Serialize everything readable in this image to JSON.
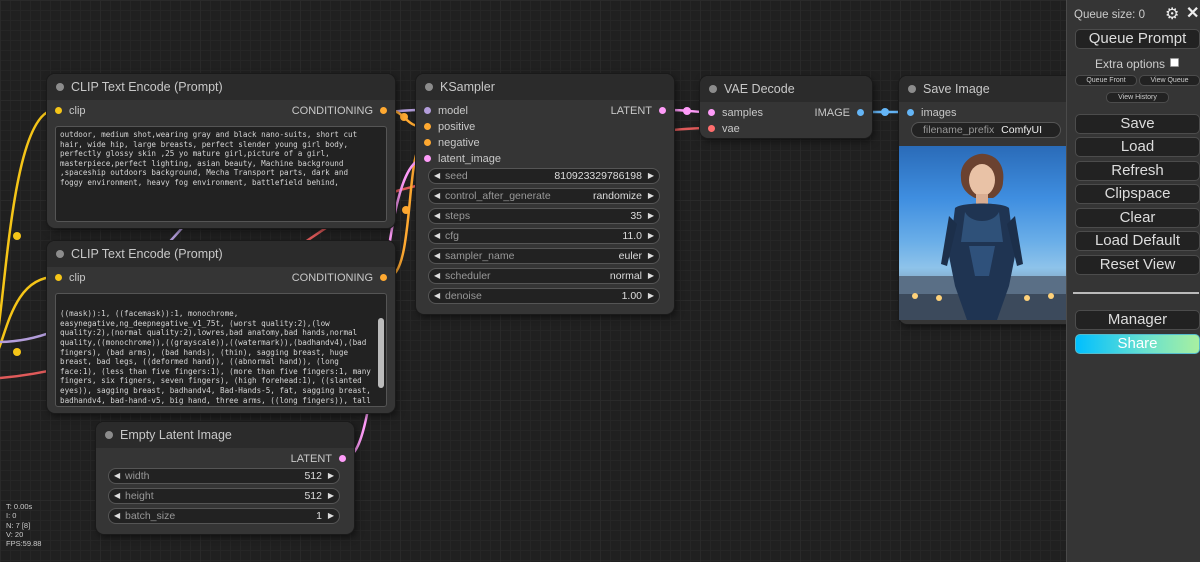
{
  "nodes": {
    "clip_pos": {
      "title": "CLIP Text Encode (Prompt)",
      "input": "clip",
      "output": "CONDITIONING",
      "text": "outdoor, medium shot,wearing gray and black nano-suits, short cut hair, wide hip, large breasts, perfect slender young girl body, perfectly glossy skin ,25 yo mature girl,picture of a girl, masterpiece,perfect lighting, asian beauty, Machine background ,spaceship outdoors background, Mecha Transport parts, dark and foggy environment, heavy fog environment, battlefield behind,"
    },
    "clip_neg": {
      "title": "CLIP Text Encode (Prompt)",
      "input": "clip",
      "output": "CONDITIONING",
      "text": "((mask)):1, ((facemask)):1, monochrome, easynegative,ng_deepnegative_v1_75t, (worst quality:2),(low quality:2),(normal quality:2),lowres,bad anatomy,bad hands,normal quality,((monochrome)),((grayscale)),((watermark)),(badhandv4),(bad fingers), (bad arms), (bad hands), (thin), sagging breast, huge breast, bad legs, ((deformed hand)), ((abnormal hand)), (long face:1), (less than five fingers:1), (more than five fingers:1, many fingers, six figners, seven fingers), (high forehead:1), ((slanted eyes)), sagging breast, badhandv4, Bad-Hands-5, fat, sagging breast, badhandv4, bad-hand-v5, big hand, three arms, ((long fingers)), tall body, long body, long legs, fat, thin, bad-hands-5, negative_hand-neg, six fingers, thress arms, three hands, fat legs, fat ass, thin body,(hand deformity, hand disability), (((small eyes, small squinting))), (((nsfw:1.5))), (((black line:1.5))), real face, small legs, thin body, ((HDA_BadHands_neg-neg))"
    },
    "latent": {
      "title": "Empty Latent Image",
      "output": "LATENT",
      "widgets": [
        {
          "label": "width",
          "value": "512"
        },
        {
          "label": "height",
          "value": "512"
        },
        {
          "label": "batch_size",
          "value": "1"
        }
      ]
    },
    "ksampler": {
      "title": "KSampler",
      "inputs": [
        "model",
        "positive",
        "negative",
        "latent_image"
      ],
      "output": "LATENT",
      "widgets": [
        {
          "label": "seed",
          "value": "810923329786198"
        },
        {
          "label": "control_after_generate",
          "value": "randomize"
        },
        {
          "label": "steps",
          "value": "35"
        },
        {
          "label": "cfg",
          "value": "11.0"
        },
        {
          "label": "sampler_name",
          "value": "euler"
        },
        {
          "label": "scheduler",
          "value": "normal"
        },
        {
          "label": "denoise",
          "value": "1.00"
        }
      ]
    },
    "vae": {
      "title": "VAE Decode",
      "inputs": [
        "samples",
        "vae"
      ],
      "output": "IMAGE"
    },
    "save": {
      "title": "Save Image",
      "input": "images",
      "prefix_label": "filename_prefix",
      "prefix_value": "ComfyUI"
    }
  },
  "colors": {
    "clip": "#f5c518",
    "conditioning": "#ffa931",
    "latent": "#ff9cf9",
    "model": "#b39ddb",
    "image": "#64b5f6",
    "vae": "#ff6e6e"
  },
  "sidebar": {
    "queue_size": "Queue size: 0",
    "queue_prompt": "Queue Prompt",
    "extra_options": "Extra options",
    "queue_front": "Queue Front",
    "view_queue": "View Queue",
    "view_history": "View History",
    "save": "Save",
    "load": "Load",
    "refresh": "Refresh",
    "clipspace": "Clipspace",
    "clear": "Clear",
    "load_default": "Load Default",
    "reset_view": "Reset View",
    "manager": "Manager",
    "share": "Share"
  },
  "stats": {
    "t": "T: 0.00s",
    "i": "I: 0",
    "n": "N: 7 [8]",
    "v": "V: 20",
    "fps": "FPS:59.88"
  }
}
